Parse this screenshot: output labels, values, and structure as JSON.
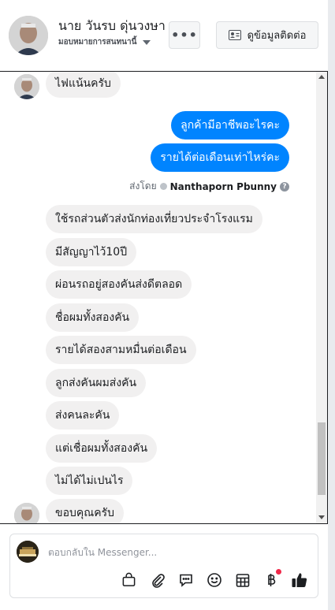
{
  "header": {
    "name": "นาย วันรบ ดุ่นวงษา",
    "role": "มอบหมายการสนทนานี้",
    "more_label": "•••",
    "contact_label": "ดูข้อมูลติดต่อ"
  },
  "messages": [
    {
      "side": "in",
      "text": "ไฟแน้นครับ"
    },
    {
      "side": "out",
      "text": "ลูกค้ามีอาชีพอะไรคะ"
    },
    {
      "side": "out",
      "text": "รายได้ต่อเดือนเท่าไหร่คะ"
    },
    {
      "side": "in",
      "text": "ใช้รถส่วนตัวส่งนักท่องเที่ยวประจำโรงแรม"
    },
    {
      "side": "in",
      "text": "มีสัญญาไว้10ปี"
    },
    {
      "side": "in",
      "text": "ผ่อนรถอยู่สองคันส่งดีตลอด"
    },
    {
      "side": "in",
      "text": "ชื่อผมทั้งสองคัน"
    },
    {
      "side": "in",
      "text": "รายได้สองสามหมื่นต่อเดือน"
    },
    {
      "side": "in",
      "text": "ลูกส่งคันผมส่งคัน"
    },
    {
      "side": "in",
      "text": "ส่งคนละคัน"
    },
    {
      "side": "in",
      "text": "แต่เชื่อผมทั้งสองคัน"
    },
    {
      "side": "in",
      "text": "ไม่ได้ไม่เปนไร"
    },
    {
      "side": "in",
      "text": "ขอบคุณครับ"
    }
  ],
  "sent_by": {
    "prefix": "ส่งโดย",
    "agent": "Nanthaporn Pbunny",
    "help": "?"
  },
  "composer": {
    "placeholder": "ตอบกลับใน Messenger..."
  },
  "toolbar_icons": [
    "bag-icon",
    "paperclip-icon",
    "saved-reply-icon",
    "emoji-icon",
    "calendar-icon",
    "baht-payment-icon",
    "like-icon"
  ],
  "colors": {
    "outgoing": "#0084ff",
    "incoming": "#f1f0f0",
    "notification_dot": "#f02849"
  }
}
